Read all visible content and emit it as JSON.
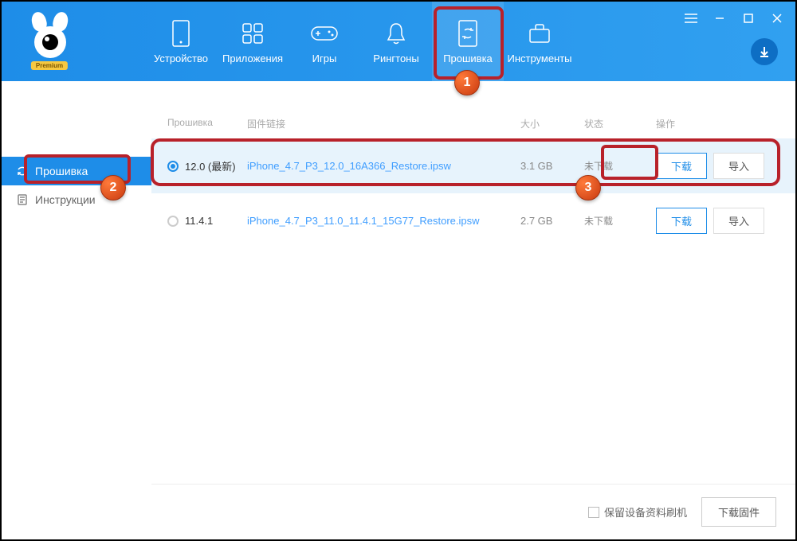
{
  "logo": {
    "premium": "Premium"
  },
  "nav": {
    "device": "Устройство",
    "apps": "Приложения",
    "games": "Игры",
    "ringtones": "Рингтоны",
    "firmware": "Прошивка",
    "tools": "Инструменты"
  },
  "sidebar": {
    "firmware": "Прошивка",
    "instructions": "Инструкции"
  },
  "table": {
    "headers": {
      "firmware": "Прошивка",
      "link": "固件链接",
      "size": "大小",
      "status": "状态",
      "action": "操作"
    },
    "rows": [
      {
        "version": "12.0 (最新)",
        "link": "iPhone_4.7_P3_12.0_16A366_Restore.ipsw",
        "size": "3.1 GB",
        "status": "未下载",
        "download": "下载",
        "import": "导入",
        "selected": true
      },
      {
        "version": "11.4.1",
        "link": "iPhone_4.7_P3_11.0_11.4.1_15G77_Restore.ipsw",
        "size": "2.7 GB",
        "status": "未下载",
        "download": "下载",
        "import": "导入",
        "selected": false
      }
    ]
  },
  "footer": {
    "keep_data": "保留设备资料刷机",
    "download_firmware": "下载固件"
  },
  "annotations": {
    "step1": "1",
    "step2": "2",
    "step3": "3"
  }
}
